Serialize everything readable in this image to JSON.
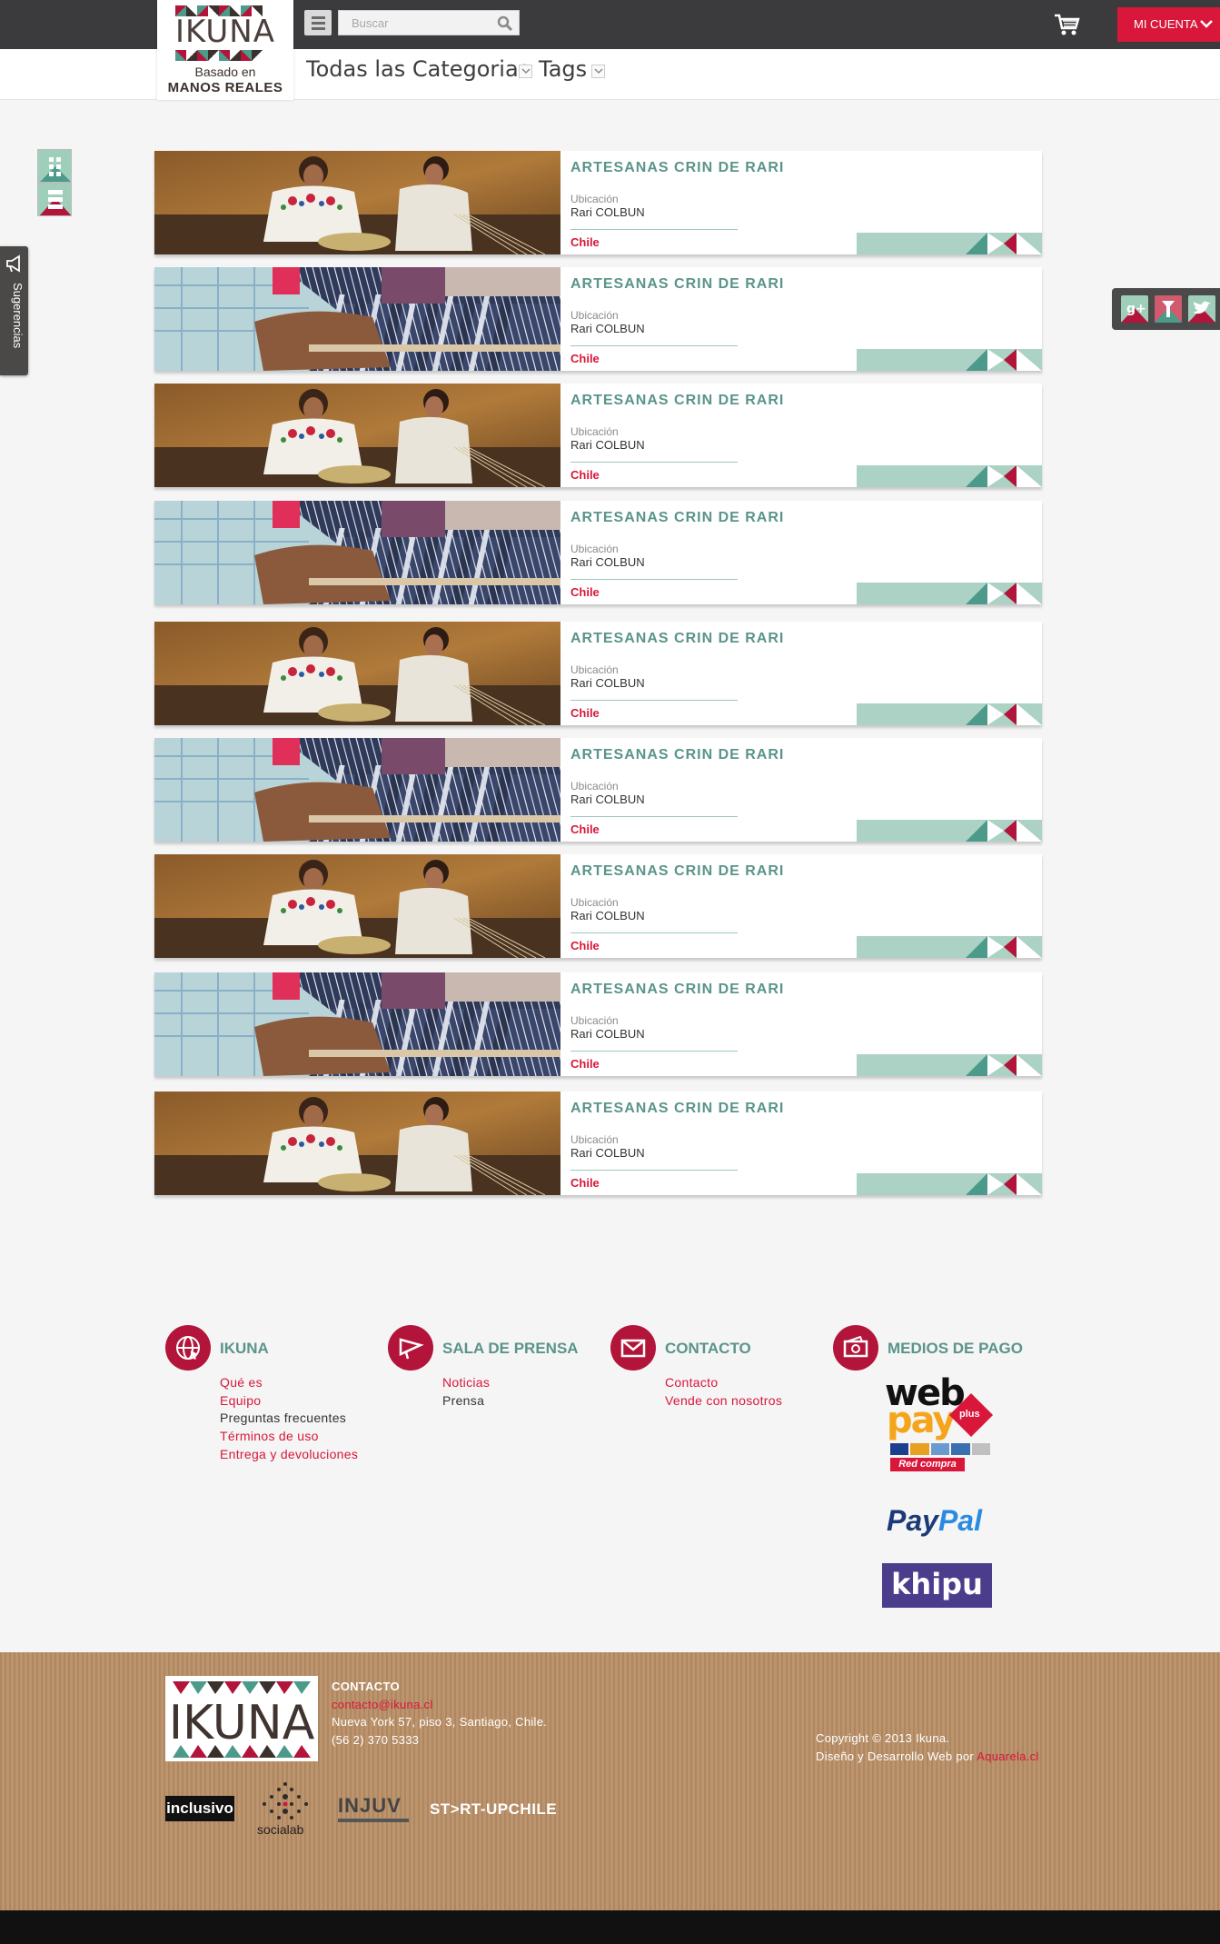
{
  "header": {
    "logo": {
      "word": "IKUNA",
      "sub1": "Basado en",
      "sub2": "MANOS REALES"
    },
    "search_placeholder": "Buscar",
    "account_label": "MI CUENTA",
    "nav": {
      "categories": "Todas las Categorias",
      "tags": "Tags"
    }
  },
  "sidebar": {
    "suggestions_label": "Sugerencias"
  },
  "social": [
    "google-plus-icon",
    "fancy-icon",
    "twitter-icon"
  ],
  "artisans": [
    {
      "title": "ARTESANAS CRIN DE RARI",
      "location_label": "Ubicación",
      "location": "Rari COLBUN",
      "country": "Chile",
      "photo": "weavers"
    },
    {
      "title": "ARTESANAS CRIN DE RARI",
      "location_label": "Ubicación",
      "location": "Rari COLBUN",
      "country": "Chile",
      "photo": "loom"
    },
    {
      "title": "ARTESANAS CRIN DE RARI",
      "location_label": "Ubicación",
      "location": "Rari COLBUN",
      "country": "Chile",
      "photo": "weavers"
    },
    {
      "title": "ARTESANAS CRIN DE RARI",
      "location_label": "Ubicación",
      "location": "Rari COLBUN",
      "country": "Chile",
      "photo": "loom"
    },
    {
      "title": "ARTESANAS CRIN DE RARI",
      "location_label": "Ubicación",
      "location": "Rari COLBUN",
      "country": "Chile",
      "photo": "weavers"
    },
    {
      "title": "ARTESANAS CRIN DE RARI",
      "location_label": "Ubicación",
      "location": "Rari COLBUN",
      "country": "Chile",
      "photo": "loom"
    },
    {
      "title": "ARTESANAS CRIN DE RARI",
      "location_label": "Ubicación",
      "location": "Rari COLBUN",
      "country": "Chile",
      "photo": "weavers"
    },
    {
      "title": "ARTESANAS CRIN DE RARI",
      "location_label": "Ubicación",
      "location": "Rari COLBUN",
      "country": "Chile",
      "photo": "loom"
    },
    {
      "title": "ARTESANAS CRIN DE RARI",
      "location_label": "Ubicación",
      "location": "Rari COLBUN",
      "country": "Chile",
      "photo": "weavers"
    }
  ],
  "footer": {
    "columns": [
      {
        "heading": "IKUNA",
        "icon": "globe-icon",
        "links": [
          {
            "label": "Qué es",
            "active": true
          },
          {
            "label": "Equipo",
            "active": true
          },
          {
            "label": "Preguntas frecuentes",
            "active": false
          },
          {
            "label": "Términos de uso",
            "active": true
          },
          {
            "label": "Entrega y devoluciones",
            "active": true
          }
        ]
      },
      {
        "heading": "SALA DE PRENSA",
        "icon": "megaphone-icon",
        "links": [
          {
            "label": "Noticias",
            "active": true
          },
          {
            "label": "Prensa",
            "active": false
          }
        ]
      },
      {
        "heading": "CONTACTO",
        "icon": "envelope-icon",
        "links": [
          {
            "label": "Contacto",
            "active": true
          },
          {
            "label": "Vende con nosotros",
            "active": true
          }
        ]
      },
      {
        "heading": "MEDIOS DE PAGO",
        "icon": "wallet-icon",
        "links": []
      }
    ],
    "payments": {
      "webpay": {
        "line1": "web",
        "line2": "pay",
        "plus": "plus",
        "redcompra": "Red compra"
      },
      "paypal": {
        "a": "Pay",
        "b": "Pal"
      },
      "khipu": "khipu"
    }
  },
  "bottom": {
    "logo_word": "IKUNA",
    "contact_heading": "CONTACTO",
    "email": "contacto@ikuna.cl",
    "address": "Nueva York 57, piso 3, Santiago, Chile.",
    "phone": "(56 2) 370 5333",
    "copyright": "Copyright © 2013 Ikuna.",
    "credits_prefix": "Diseño y Desarrollo Web por",
    "credits_link": "Aquarela.cl",
    "partners": {
      "inclusivo": "inclusivo",
      "socialab": "socialab",
      "injuv": "INJUV",
      "startup": "ST>RT-UPCHILE"
    }
  },
  "colors": {
    "accent": "#d8173a",
    "teal": "#5a948a",
    "ribbon": "#abd2c4",
    "topbar": "#3b3a3c",
    "burgundy": "#b21539"
  }
}
